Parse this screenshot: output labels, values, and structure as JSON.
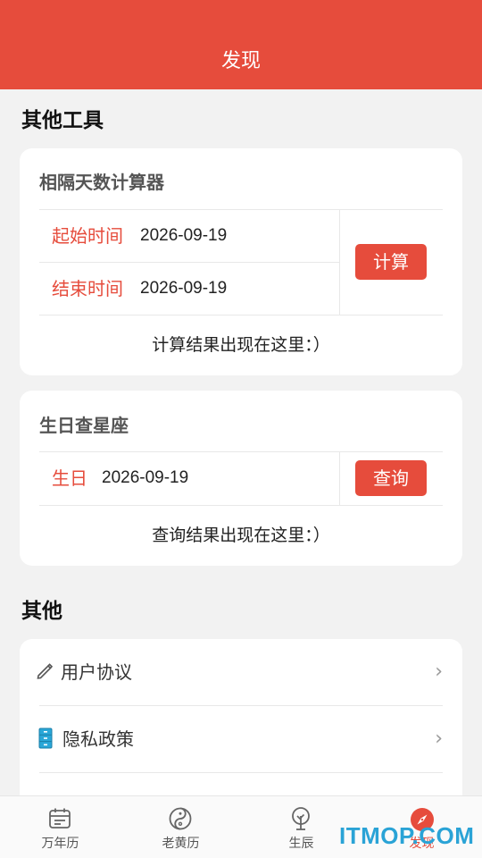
{
  "header": {
    "title": "发现"
  },
  "tools": {
    "section_title": "其他工具",
    "days_calc": {
      "title": "相隔天数计算器",
      "start_label": "起始时间",
      "start_value": "2026-09-19",
      "end_label": "结束时间",
      "end_value": "2026-09-19",
      "button_label": "计算",
      "result_text": "计算结果出现在这里：）"
    },
    "zodiac": {
      "title": "生日查星座",
      "birthday_label": "生日",
      "birthday_value": "2026-09-19",
      "button_label": "查询",
      "result_text": "查询结果出现在这里：）"
    }
  },
  "other": {
    "section_title": "其他",
    "items": [
      {
        "label": "用户协议",
        "icon": "pencil-icon"
      },
      {
        "label": "隐私政策",
        "icon": "cabinet-icon"
      }
    ]
  },
  "tabbar": {
    "tabs": [
      {
        "label": "万年历",
        "icon": "calendar-icon"
      },
      {
        "label": "老黄历",
        "icon": "yin-yang-icon"
      },
      {
        "label": "生辰",
        "icon": "tree-icon"
      },
      {
        "label": "发现",
        "icon": "compass-icon",
        "active": true
      }
    ]
  },
  "watermark": {
    "text": "ITMOP.COM"
  },
  "colors": {
    "accent": "#e64c3c",
    "background": "#f2f2f2",
    "card": "#ffffff",
    "watermark": "#2aa3d6"
  }
}
